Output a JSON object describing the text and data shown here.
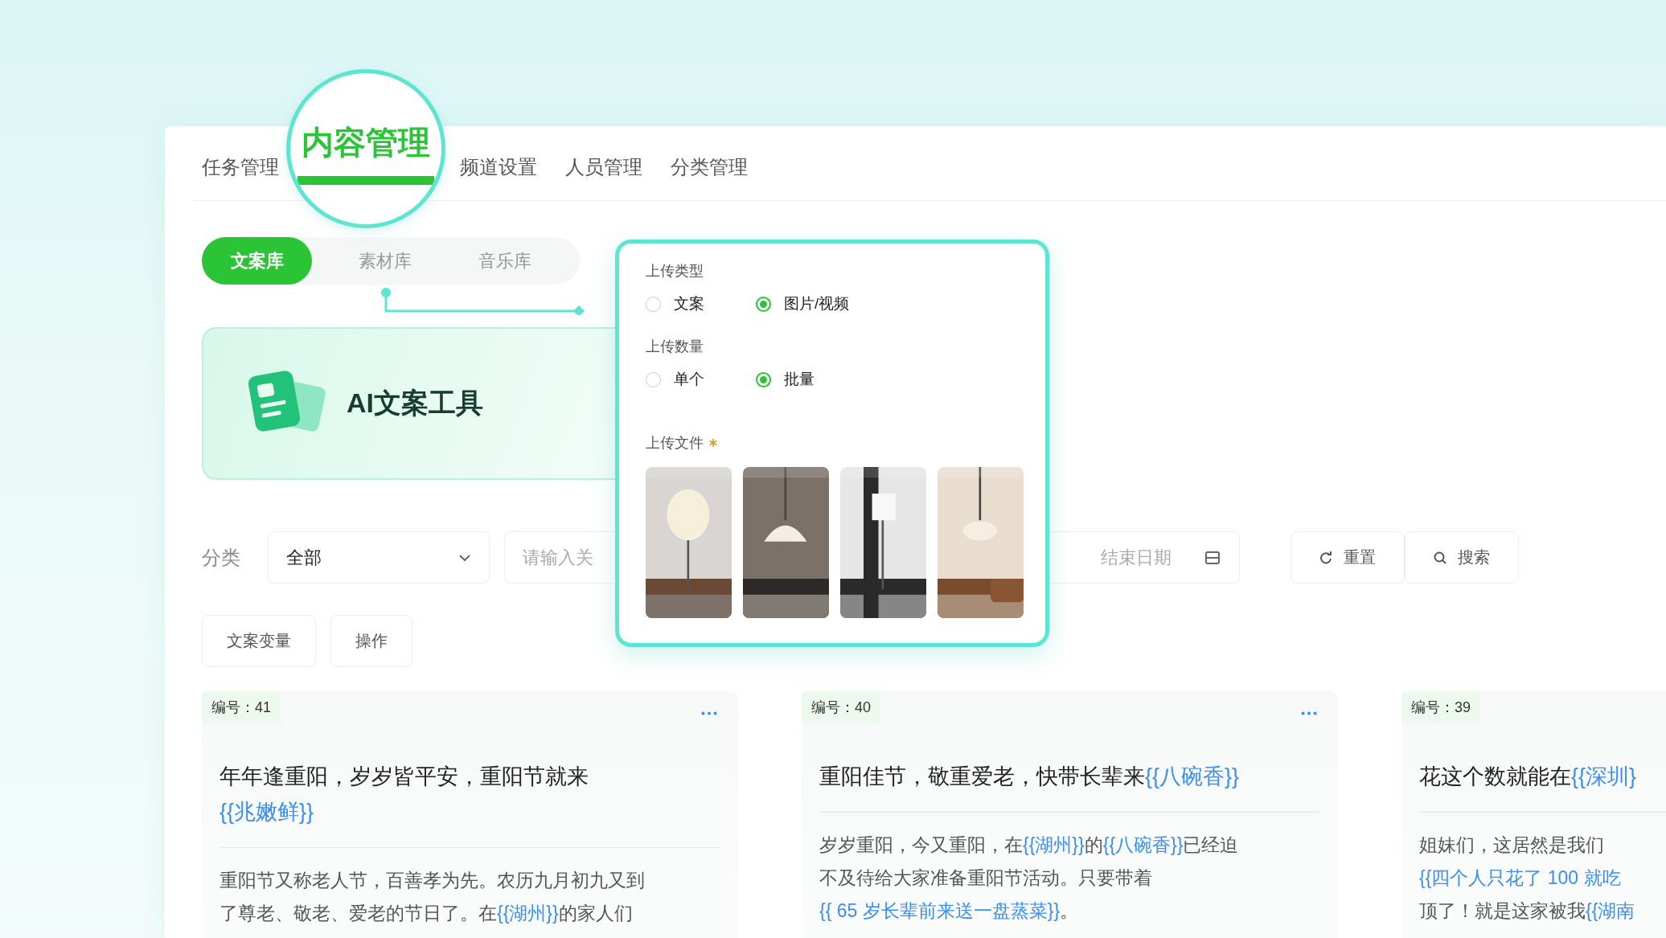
{
  "nav": {
    "tabs": [
      {
        "label": "任务管理",
        "selected": false
      },
      {
        "label": "内容管理",
        "selected": true
      },
      {
        "label": "频道设置",
        "selected": false
      },
      {
        "label": "人员管理",
        "selected": false
      },
      {
        "label": "分类管理",
        "selected": false
      }
    ]
  },
  "library_tabs": [
    {
      "label": "文案库",
      "selected": true
    },
    {
      "label": "素材库",
      "selected": false
    },
    {
      "label": "音乐库",
      "selected": false
    }
  ],
  "banner": {
    "title": "AI文案工具"
  },
  "filters": {
    "category_label": "分类",
    "category_value": "全部",
    "keyword_placeholder": "请输入关",
    "end_date_placeholder": "结束日期",
    "reset": "重置",
    "search": "搜索"
  },
  "actions": [
    "文案变量",
    "操作"
  ],
  "upload_popup": {
    "groups": [
      {
        "label": "上传类型",
        "options": [
          {
            "label": "文案",
            "selected": false
          },
          {
            "label": "图片/视频",
            "selected": true
          }
        ]
      },
      {
        "label": "上传数量",
        "options": [
          {
            "label": "单个",
            "selected": false
          },
          {
            "label": "批量",
            "selected": true
          }
        ]
      }
    ],
    "files_label": "上传文件",
    "required": true
  },
  "cards": [
    {
      "number": "编号：41",
      "title": [
        [
          {
            "text": "年年逢重阳，岁岁皆平安，重阳节就来",
            "kind": "plain"
          }
        ],
        [
          {
            "text": "{{兆嫩鲜}}",
            "kind": "variable"
          }
        ]
      ],
      "body": [
        [
          {
            "text": "重阳节又称老人节，百善孝为先。农历九月初九又到",
            "kind": "plain"
          }
        ],
        [
          {
            "text": "了尊老、敬老、爱老的节日了。在",
            "kind": "plain"
          },
          {
            "text": "{{湖州}}",
            "kind": "variable"
          },
          {
            "text": "的家人们",
            "kind": "plain"
          }
        ]
      ]
    },
    {
      "number": "编号：40",
      "title": [
        [
          {
            "text": "重阳佳节，敬重爱老，快带长辈来",
            "kind": "plain"
          },
          {
            "text": "{{八碗香}}",
            "kind": "variable"
          }
        ]
      ],
      "body": [
        [
          {
            "text": "岁岁重阳，今又重阳，在",
            "kind": "plain"
          },
          {
            "text": "{{湖州}}",
            "kind": "variable"
          },
          {
            "text": "的",
            "kind": "plain"
          },
          {
            "text": "{{八碗香}}",
            "kind": "variable"
          },
          {
            "text": "已经迫",
            "kind": "plain"
          }
        ],
        [
          {
            "text": "不及待给大家准备重阳节活动。只要带着",
            "kind": "plain"
          }
        ],
        [
          {
            "text": "{{ 65 岁长辈前来送一盘蒸菜}}",
            "kind": "variable"
          },
          {
            "text": "。",
            "kind": "plain"
          }
        ]
      ]
    },
    {
      "number": "编号：39",
      "title": [
        [
          {
            "text": "花这个数就能在",
            "kind": "plain"
          },
          {
            "text": "{{深圳}",
            "kind": "variable"
          }
        ]
      ],
      "body": [
        [
          {
            "text": "姐妹们，这居然是我们",
            "kind": "plain"
          }
        ],
        [
          {
            "text": "{{四个人只花了 100 就吃",
            "kind": "variable"
          }
        ],
        [
          {
            "text": "顶了！就是这家被我",
            "kind": "plain"
          },
          {
            "text": "{{湖南",
            "kind": "variable"
          }
        ]
      ]
    }
  ]
}
